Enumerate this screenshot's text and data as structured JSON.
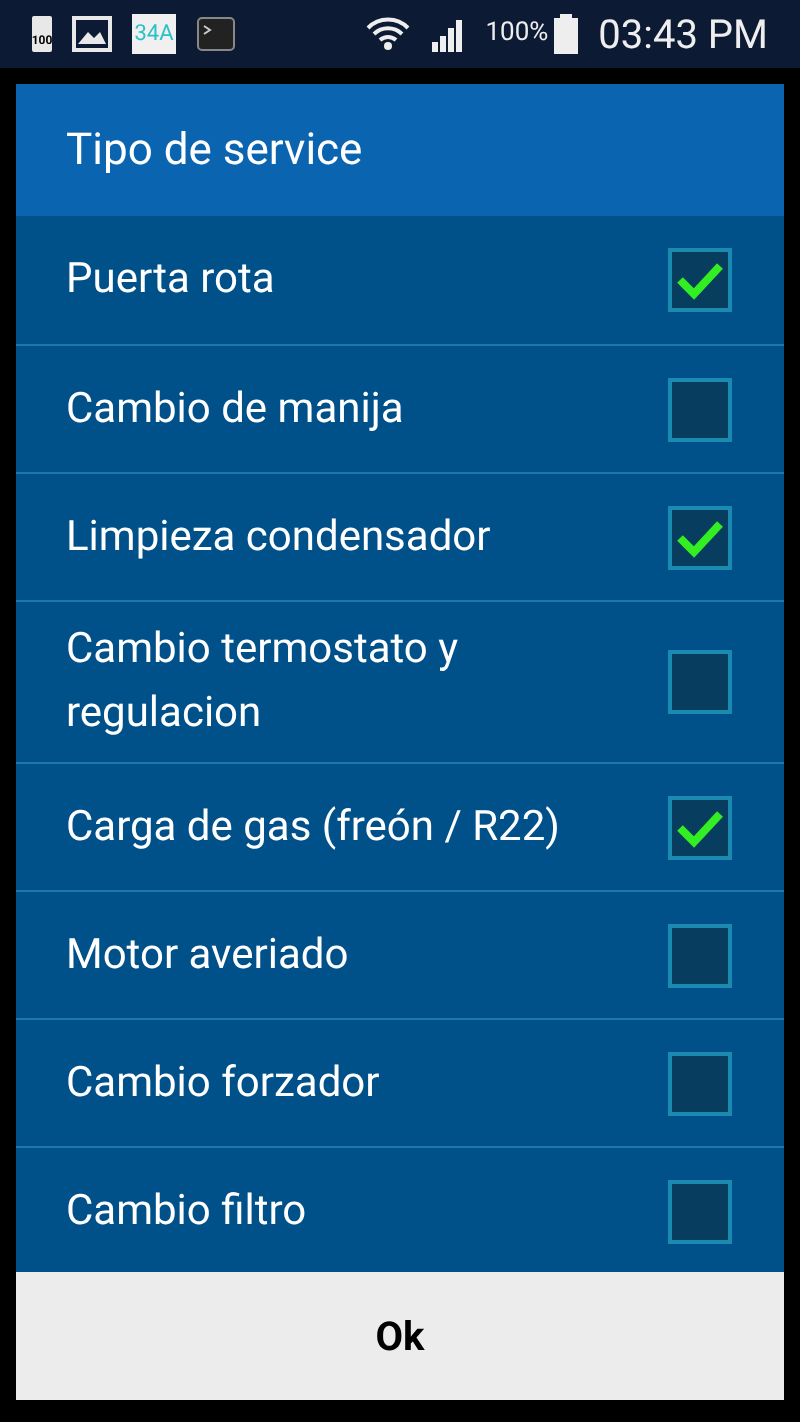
{
  "status_bar": {
    "notifications": [
      {
        "kind": "battery",
        "text": "100"
      },
      {
        "kind": "image"
      },
      {
        "kind": "app",
        "text": "34A"
      },
      {
        "kind": "terminal"
      }
    ],
    "battery_percent": "100%",
    "time": "03:43 PM"
  },
  "dialog": {
    "title": "Tipo de service",
    "items": [
      {
        "label": "Puerta rota",
        "checked": true
      },
      {
        "label": "Cambio de manija",
        "checked": false
      },
      {
        "label": "Limpieza condensador",
        "checked": true
      },
      {
        "label": "Cambio termostato y regulacion",
        "checked": false
      },
      {
        "label": "Carga de gas (freón / R22)",
        "checked": true
      },
      {
        "label": "Motor averiado",
        "checked": false
      },
      {
        "label": "Cambio forzador",
        "checked": false
      },
      {
        "label": "Cambio filtro",
        "checked": false
      }
    ],
    "button": "Ok"
  }
}
